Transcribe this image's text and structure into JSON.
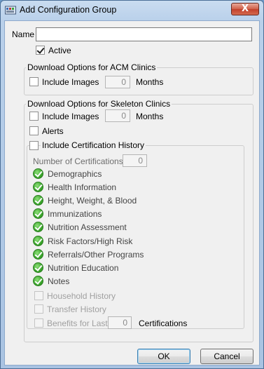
{
  "window": {
    "title": "Add Configuration Group",
    "close_symbol": "X"
  },
  "form": {
    "name_label": "Name",
    "name_value": "",
    "active_label": "Active",
    "active_checked": true
  },
  "acm": {
    "legend": "Download Options for ACM Clinics",
    "include_images_label": "Include Images",
    "months_value": "0",
    "months_label": "Months"
  },
  "skeleton": {
    "legend": "Download Options for Skeleton Clinics",
    "include_images_label": "Include Images",
    "months_value": "0",
    "months_label": "Months",
    "alerts_label": "Alerts",
    "cert_history": {
      "legend": "Include Certification History",
      "num_certs_label": "Number of Certifications",
      "num_certs_value": "0",
      "checked_items": [
        "Demographics",
        "Health Information",
        "Height, Weight, & Blood",
        "Immunizations",
        "Nutrition Assessment",
        "Risk Factors/High Risk",
        "Referrals/Other Programs",
        "Nutrition Education",
        "Notes"
      ],
      "household_label": "Household History",
      "transfer_label": "Transfer History",
      "benefits_label": "Benefits for Last",
      "benefits_value": "0",
      "certifications_label": "Certifications"
    }
  },
  "buttons": {
    "ok": "OK",
    "cancel": "Cancel"
  },
  "icons": {
    "app": "app-icon",
    "close": "close-icon",
    "item_check": "green-check-icon"
  },
  "colors": {
    "titlebar": "#b9d0ea",
    "close": "#c2402a",
    "check": "#3aa52b"
  }
}
